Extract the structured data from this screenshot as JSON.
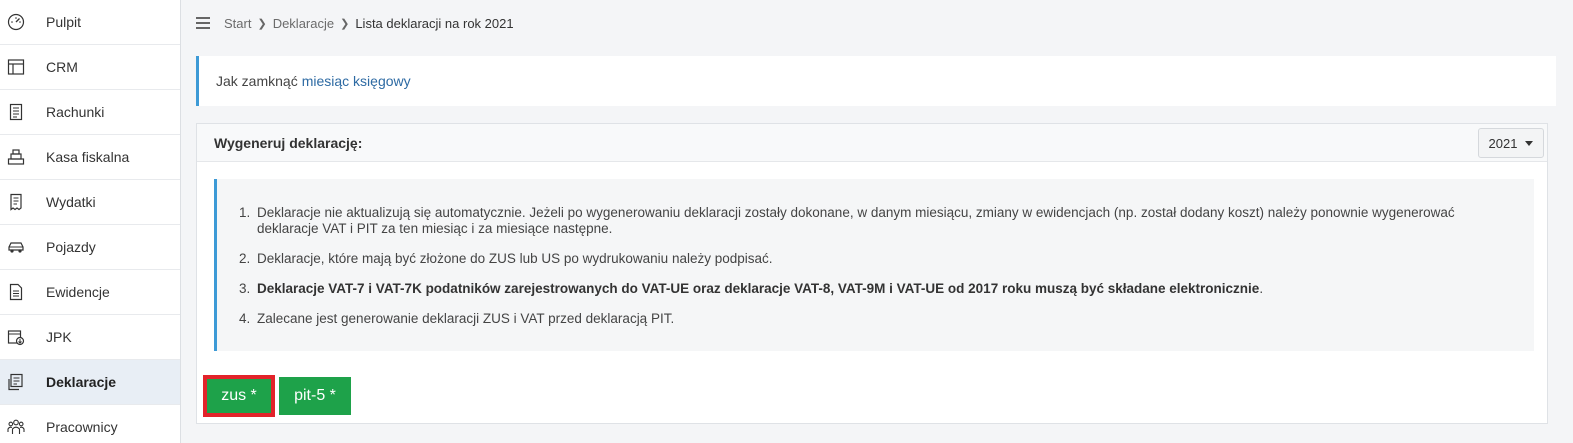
{
  "sidebar": {
    "items": [
      {
        "label": "Pulpit",
        "icon": "dashboard-icon"
      },
      {
        "label": "CRM",
        "icon": "crm-icon"
      },
      {
        "label": "Rachunki",
        "icon": "invoice-icon"
      },
      {
        "label": "Kasa fiskalna",
        "icon": "cash-register-icon"
      },
      {
        "label": "Wydatki",
        "icon": "receipt-icon"
      },
      {
        "label": "Pojazdy",
        "icon": "car-icon"
      },
      {
        "label": "Ewidencje",
        "icon": "document-icon"
      },
      {
        "label": "JPK",
        "icon": "jpk-icon"
      },
      {
        "label": "Deklaracje",
        "icon": "declaration-icon",
        "active": true
      },
      {
        "label": "Pracownicy",
        "icon": "employees-icon"
      }
    ]
  },
  "breadcrumb": {
    "items": [
      "Start",
      "Deklaracje"
    ],
    "current": "Lista deklaracji na rok 2021"
  },
  "alert": {
    "text": "Jak zamknąć",
    "link": "miesiąc księgowy"
  },
  "card": {
    "title": "Wygeneruj deklarację:",
    "year": "2021"
  },
  "info": {
    "items": [
      {
        "num": "1.",
        "text": "Deklaracje nie aktualizują się automatycznie. Jeżeli po wygenerowaniu deklaracji zostały dokonane, w danym miesiącu, zmiany w ewidencjach (np. został dodany koszt) należy ponownie wygenerować deklaracje VAT i PIT za ten miesiąc i za miesiące następne."
      },
      {
        "num": "2.",
        "text": "Deklaracje, które mają być złożone do ZUS lub US po wydrukowaniu należy podpisać."
      },
      {
        "num": "3.",
        "bold": "Deklaracje VAT-7 i VAT-7K podatników zarejestrowanych do VAT-UE oraz deklaracje VAT-8, VAT-9M i VAT-UE od 2017 roku muszą być składane elektronicznie",
        "tail": "."
      },
      {
        "num": "4.",
        "text": "Zalecane jest generowanie deklaracji ZUS i VAT przed deklaracją PIT."
      }
    ]
  },
  "buttons": {
    "zus": "zus *",
    "pit": "pit-5 *"
  },
  "colors": {
    "accent": "#3d9ad6",
    "button_green": "#1ea24a",
    "highlight_red": "#e2232a"
  }
}
